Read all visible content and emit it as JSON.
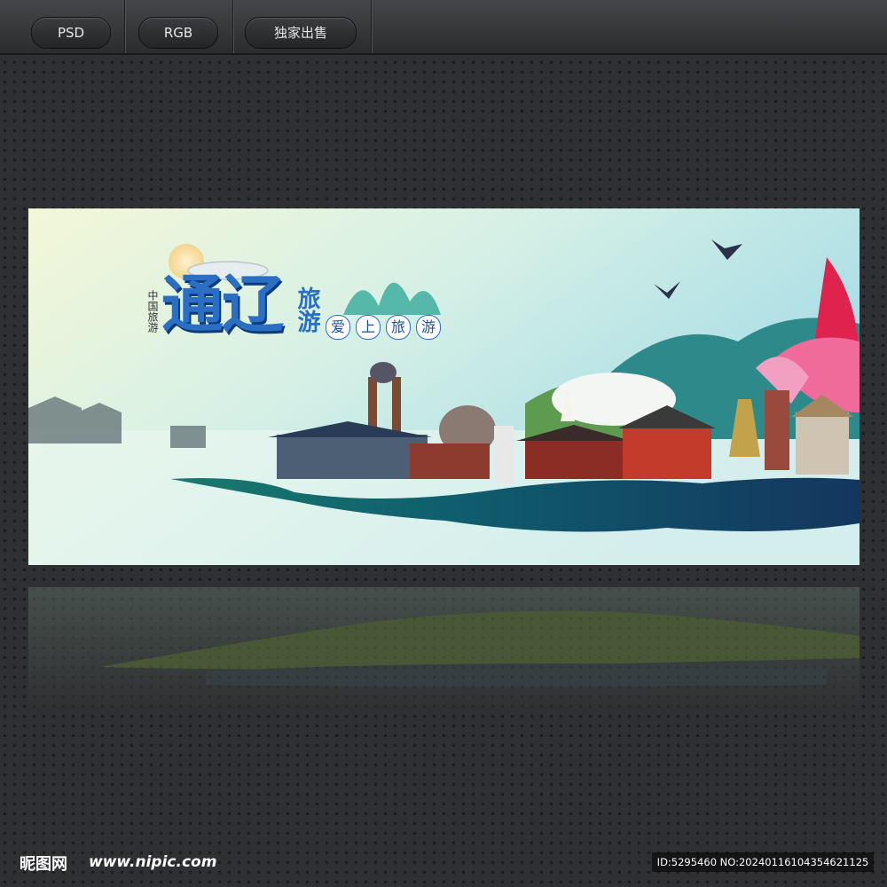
{
  "toolbar": {
    "tabs": [
      {
        "label": "PSD"
      },
      {
        "label": "RGB"
      },
      {
        "label": "独家出售"
      }
    ]
  },
  "banner": {
    "side_label": "中国旅游",
    "title": "通辽",
    "subtitle_vertical": "旅游",
    "slogan": [
      "爱",
      "上",
      "旅",
      "游"
    ]
  },
  "footer": {
    "logo": "昵图网",
    "url": "www.nipic.com",
    "id_text": "ID:5295460 NO:20240116104354621125"
  },
  "colors": {
    "background": "#2f3033",
    "title_blue": "#2a6fc4",
    "ink_teal": "#0f6a6e",
    "ink_navy": "#12355e",
    "lotus_pink": "#e8386c"
  }
}
